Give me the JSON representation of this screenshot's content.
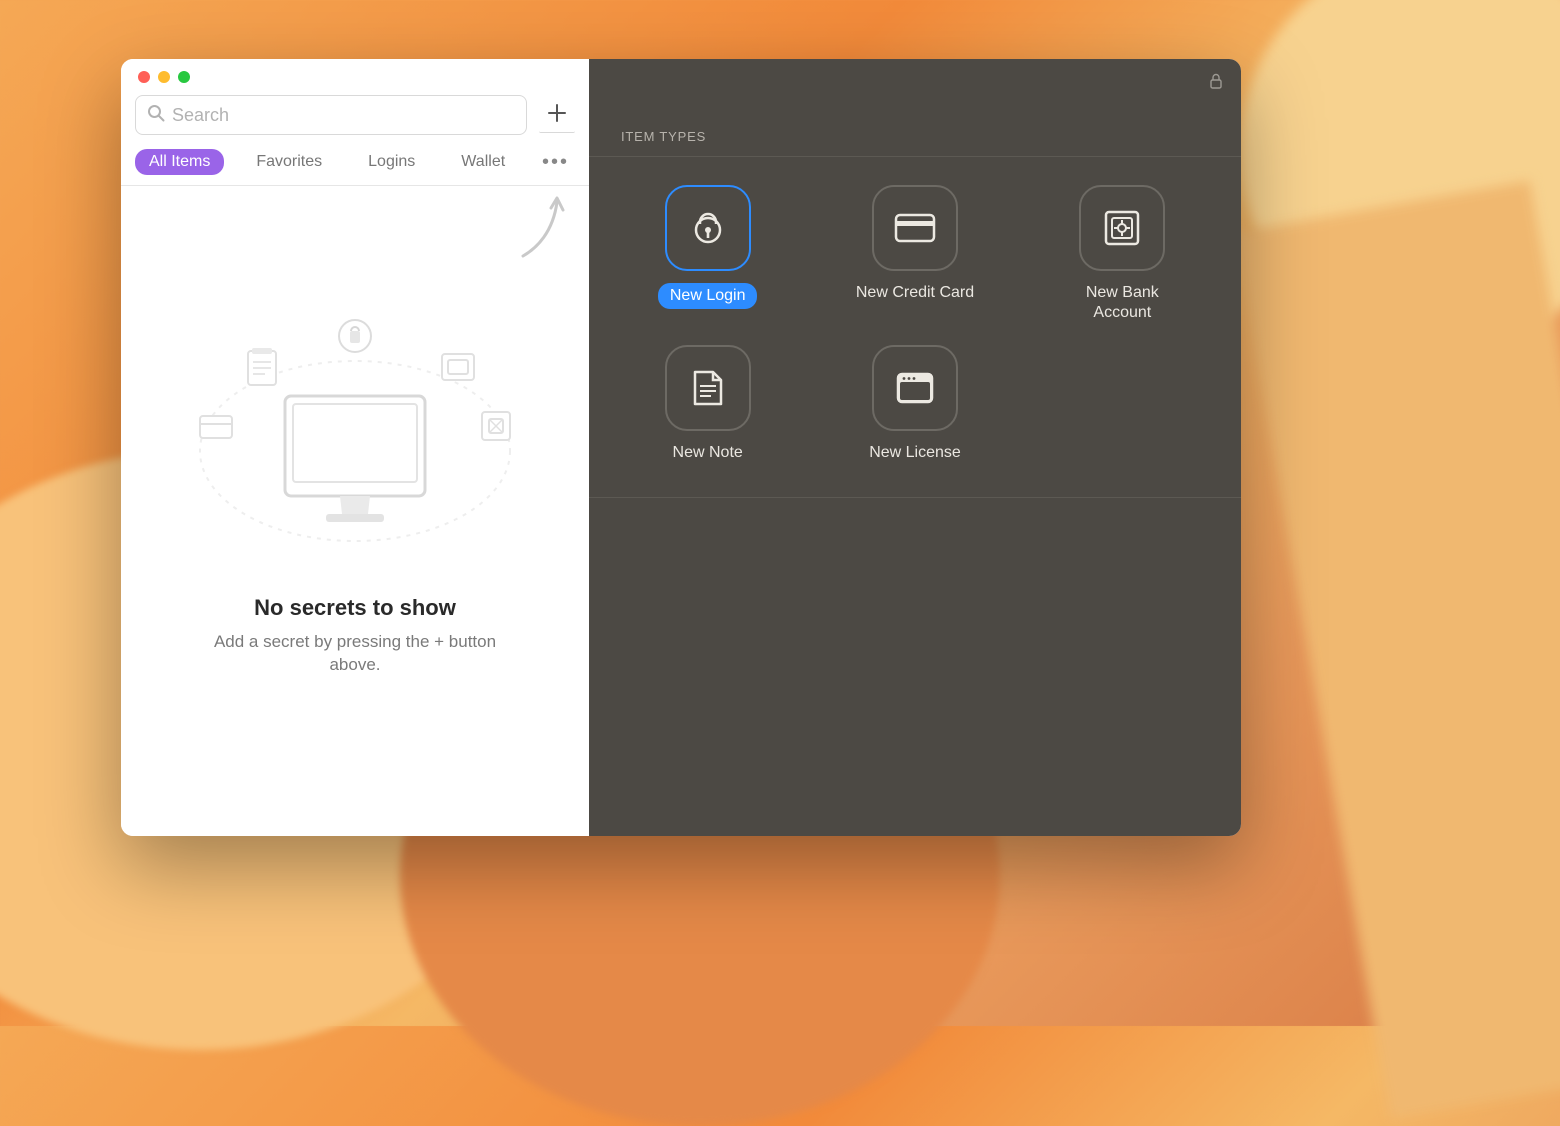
{
  "search": {
    "placeholder": "Search",
    "value": ""
  },
  "tabs": {
    "items": [
      {
        "label": "All Items",
        "active": true
      },
      {
        "label": "Favorites",
        "active": false
      },
      {
        "label": "Logins",
        "active": false
      },
      {
        "label": "Wallet",
        "active": false
      }
    ]
  },
  "empty_state": {
    "title": "No secrets to show",
    "subtitle": "Add a secret by pressing the + button above."
  },
  "right_panel": {
    "section_label": "ITEM TYPES",
    "types": [
      {
        "id": "login",
        "label": "New Login",
        "selected": true
      },
      {
        "id": "credit-card",
        "label": "New Credit Card",
        "selected": false
      },
      {
        "id": "bank-account",
        "label": "New Bank Account",
        "selected": false
      },
      {
        "id": "note",
        "label": "New Note",
        "selected": false
      },
      {
        "id": "license",
        "label": "New License",
        "selected": false
      }
    ]
  }
}
